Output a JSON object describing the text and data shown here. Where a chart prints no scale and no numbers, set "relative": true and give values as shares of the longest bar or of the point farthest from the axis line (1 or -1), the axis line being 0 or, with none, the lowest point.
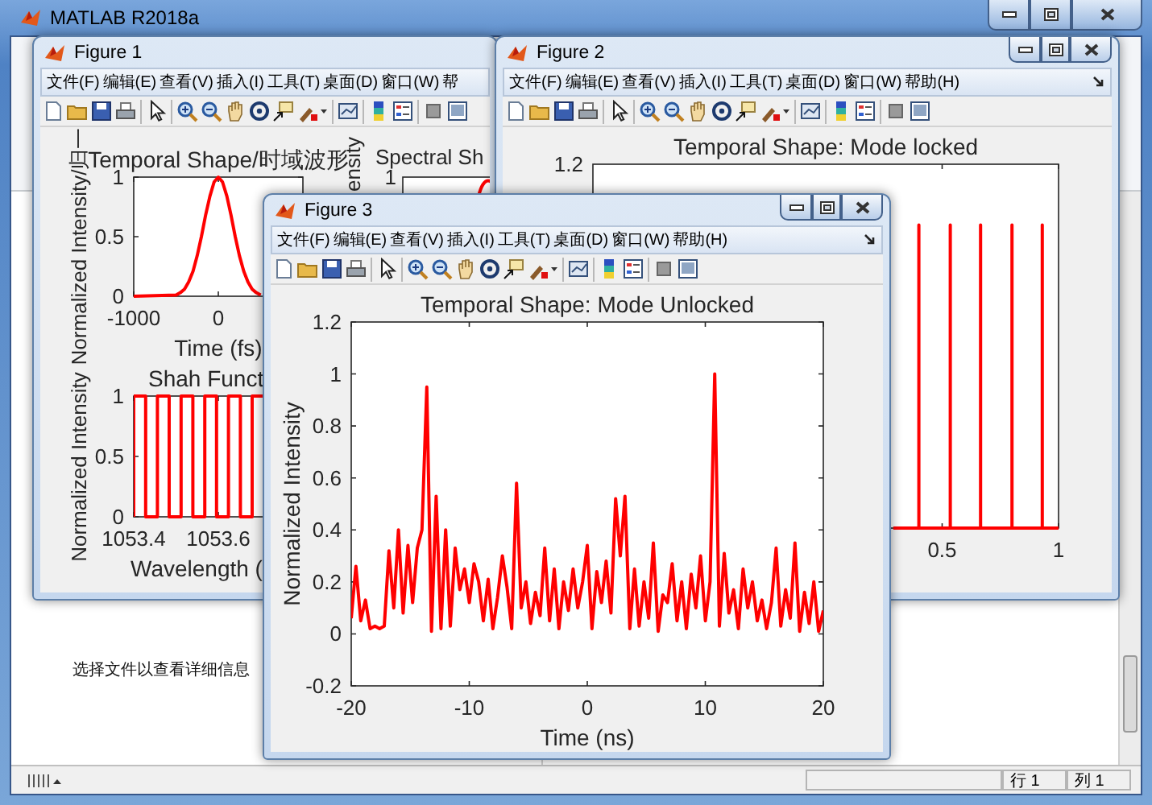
{
  "main_window": {
    "title": "MATLAB R2018a",
    "file_details_hint": "选择文件以查看详细信息",
    "status_bar": {
      "line": "行 1",
      "column": "列 1"
    }
  },
  "figures": [
    {
      "title": "Figure 1",
      "menu": [
        "文件(F)",
        "编辑(E)",
        "查看(V)",
        "插入(I)",
        "工具(T)",
        "桌面(D)",
        "窗口(W)",
        "帮"
      ],
      "plots": [
        {
          "kind": "chart",
          "chart_data": {
            "type": "line",
            "title": "Temporal Shape/时域波形",
            "xlabel": "Time (fs)",
            "ylabel": "Normalized Intensity/归一",
            "x": [
              -1000,
              -500,
              -450,
              -400,
              -350,
              -300,
              -250,
              -200,
              -150,
              -100,
              -50,
              0,
              50,
              100,
              150,
              200,
              250,
              300,
              350,
              400,
              450,
              500
            ],
            "series": [
              {
                "color": "#ff0000",
                "values": [
                  0,
                  0.01,
                  0.03,
                  0.06,
                  0.12,
                  0.21,
                  0.34,
                  0.5,
                  0.68,
                  0.84,
                  0.96,
                  1,
                  0.96,
                  0.84,
                  0.68,
                  0.5,
                  0.34,
                  0.21,
                  0.12,
                  0.06,
                  0.03,
                  0.01
                ]
              }
            ],
            "xlim": [
              -1000,
              1000
            ],
            "ylim": [
              0,
              1
            ],
            "xticks": [
              -1000,
              0
            ],
            "yticks": [
              0,
              0.5,
              1
            ]
          }
        },
        {
          "kind": "partial",
          "title": "Spectral Sh",
          "ylabel": "ensity",
          "ytick": "1"
        },
        {
          "kind": "chart",
          "chart_data": {
            "type": "line",
            "title": "Shah Funct",
            "xlabel": "Wavelength (",
            "ylabel": "Normalized Intensity",
            "x": [
              1053.4,
              1053.4,
              1053.428,
              1053.428,
              1053.456,
              1053.456,
              1053.484,
              1053.484,
              1053.512,
              1053.512,
              1053.54,
              1053.54,
              1053.568,
              1053.568,
              1053.596,
              1053.596,
              1053.624,
              1053.624,
              1053.652,
              1053.652,
              1053.68,
              1053.68,
              1053.708
            ],
            "series": [
              {
                "color": "#ff0000",
                "values": [
                  0,
                  1,
                  1,
                  0,
                  0,
                  1,
                  1,
                  0,
                  0,
                  1,
                  1,
                  0,
                  0,
                  1,
                  1,
                  0,
                  0,
                  1,
                  1,
                  0,
                  0,
                  1,
                  1
                ]
              }
            ],
            "xlim": [
              1053.4,
              1053.8
            ],
            "ylim": [
              0,
              1
            ],
            "xticks": [
              1053.4,
              1053.6
            ],
            "yticks": [
              0,
              0.5,
              1
            ]
          }
        }
      ]
    },
    {
      "title": "Figure 2",
      "window_buttons": true,
      "dock_button": true,
      "menu": [
        "文件(F)",
        "编辑(E)",
        "查看(V)",
        "插入(I)",
        "工具(T)",
        "桌面(D)",
        "窗口(W)",
        "帮助(H)"
      ],
      "plots": [
        {
          "kind": "chart",
          "chart_data": {
            "type": "line",
            "title": "Temporal Shape: Mode locked",
            "x": [
              0.29,
              0.4,
              0.4,
              0.4,
              0.535,
              0.535,
              0.535,
              0.665,
              0.665,
              0.665,
              0.8,
              0.8,
              0.8,
              0.93,
              0.93,
              0.93,
              1
            ],
            "series": [
              {
                "color": "#ff0000",
                "values": [
                  0,
                  0,
                  1,
                  0,
                  0,
                  1,
                  0,
                  0,
                  1,
                  0,
                  0,
                  1,
                  0,
                  0,
                  1,
                  0,
                  0
                ]
              }
            ],
            "xlim": [
              -1,
              1
            ],
            "relative": true,
            "xticks": [
              0.5,
              1
            ],
            "annotations": [
              {
                "text": "1.2"
              }
            ]
          }
        }
      ]
    },
    {
      "title": "Figure 3",
      "window_buttons": true,
      "dock_button": true,
      "menu": [
        "文件(F)",
        "编辑(E)",
        "查看(V)",
        "插入(I)",
        "工具(T)",
        "桌面(D)",
        "窗口(W)",
        "帮助(H)"
      ],
      "plots": [
        {
          "kind": "chart",
          "chart_data": {
            "type": "line",
            "title": "Temporal Shape: Mode Unlocked",
            "xlabel": "Time (ns)",
            "ylabel": "Normalized Intensity",
            "x": [
              -20,
              -19.6,
              -19.2,
              -18.8,
              -18.4,
              -18,
              -17.6,
              -17.2,
              -16.8,
              -16.4,
              -16,
              -15.6,
              -15.2,
              -14.8,
              -14.4,
              -14,
              -13.6,
              -13.2,
              -12.8,
              -12.4,
              -12,
              -11.6,
              -11.2,
              -10.8,
              -10.4,
              -10,
              -9.6,
              -9.2,
              -8.8,
              -8.4,
              -8,
              -7.6,
              -7.2,
              -6.8,
              -6.4,
              -6,
              -5.6,
              -5.2,
              -4.8,
              -4.4,
              -4,
              -3.6,
              -3.2,
              -2.8,
              -2.4,
              -2,
              -1.6,
              -1.2,
              -0.8,
              -0.4,
              0,
              0.4,
              0.8,
              1.2,
              1.6,
              2,
              2.4,
              2.8,
              3.2,
              3.6,
              4,
              4.4,
              4.8,
              5.2,
              5.6,
              6,
              6.4,
              6.8,
              7.2,
              7.6,
              8,
              8.4,
              8.8,
              9.2,
              9.6,
              10,
              10.4,
              10.8,
              11.2,
              11.6,
              12,
              12.4,
              12.8,
              13.2,
              13.6,
              14,
              14.4,
              14.8,
              15.2,
              15.6,
              16,
              16.4,
              16.8,
              17.2,
              17.6,
              18,
              18.4,
              18.8,
              19.2,
              19.6,
              20
            ],
            "series": [
              {
                "color": "#ff0000",
                "values": [
                  0.06,
                  0.26,
                  0.05,
                  0.13,
                  0.02,
                  0.03,
                  0.02,
                  0.03,
                  0.32,
                  0.1,
                  0.4,
                  0.08,
                  0.34,
                  0.12,
                  0.33,
                  0.4,
                  0.95,
                  0.01,
                  0.53,
                  0.02,
                  0.4,
                  0.03,
                  0.33,
                  0.17,
                  0.25,
                  0.12,
                  0.27,
                  0.2,
                  0.05,
                  0.21,
                  0.02,
                  0.14,
                  0.3,
                  0.18,
                  0.02,
                  0.58,
                  0.1,
                  0.2,
                  0.04,
                  0.16,
                  0.07,
                  0.33,
                  0.05,
                  0.25,
                  0.02,
                  0.2,
                  0.09,
                  0.25,
                  0.1,
                  0.2,
                  0.34,
                  0.02,
                  0.24,
                  0.12,
                  0.28,
                  0.08,
                  0.52,
                  0.3,
                  0.53,
                  0.02,
                  0.25,
                  0.03,
                  0.2,
                  0.06,
                  0.35,
                  0.01,
                  0.15,
                  0.12,
                  0.27,
                  0.05,
                  0.2,
                  0.02,
                  0.23,
                  0.1,
                  0.3,
                  0.05,
                  0.2,
                  1,
                  0.03,
                  0.31,
                  0.08,
                  0.17,
                  0.02,
                  0.25,
                  0.1,
                  0.2,
                  0.05,
                  0.13,
                  0.02,
                  0.12,
                  0.33,
                  0.03,
                  0.17,
                  0.06,
                  0.35,
                  0.01,
                  0.16,
                  0.04,
                  0.2,
                  0.01,
                  0.09
                ]
              }
            ],
            "xlim": [
              -20,
              20
            ],
            "ylim": [
              -0.2,
              1.2
            ],
            "xticks": [
              -20,
              -10,
              0,
              10,
              20
            ],
            "yticks": [
              -0.2,
              0,
              0.2,
              0.4,
              0.6,
              0.8,
              1,
              1.2
            ]
          }
        }
      ]
    }
  ]
}
